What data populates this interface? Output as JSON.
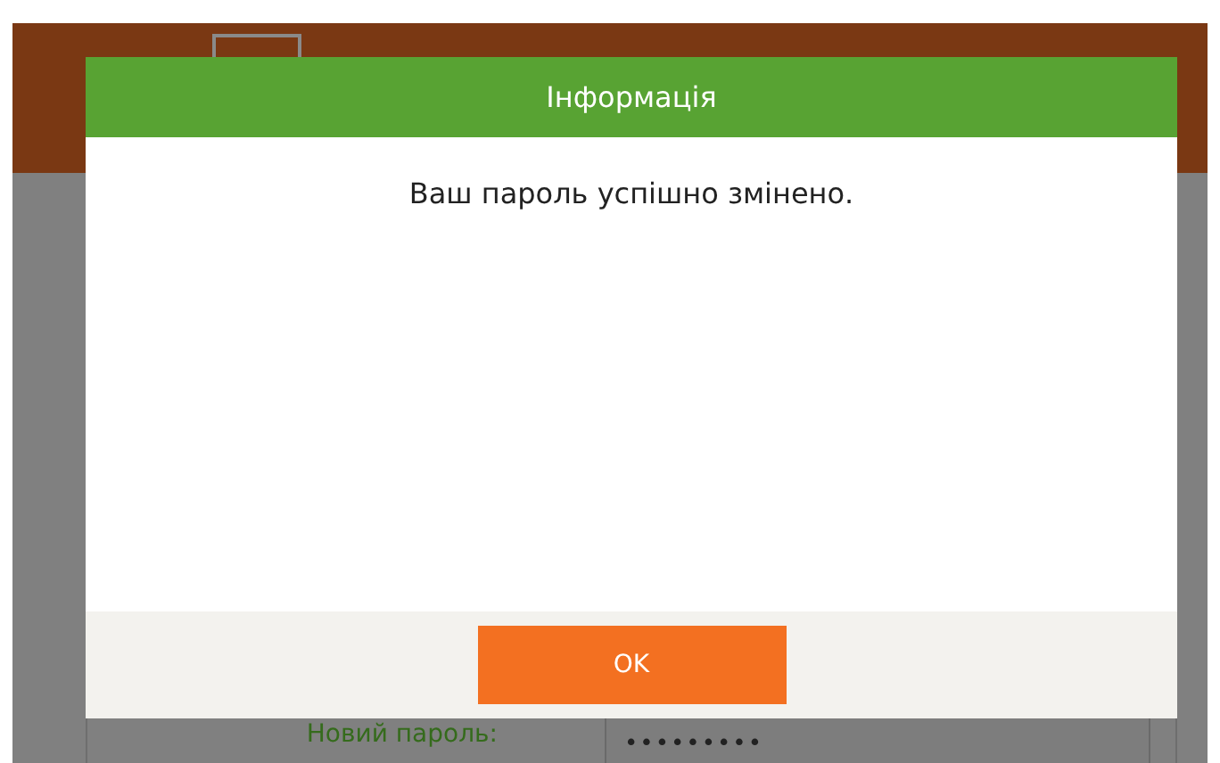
{
  "form": {
    "fields": [
      {
        "label": "Новий пароль:",
        "value": "•••••••••"
      }
    ]
  },
  "dialog": {
    "title": "Інформація",
    "message": "Ваш пароль успішно змінено.",
    "buttons": [
      {
        "label": "OK"
      }
    ]
  }
}
